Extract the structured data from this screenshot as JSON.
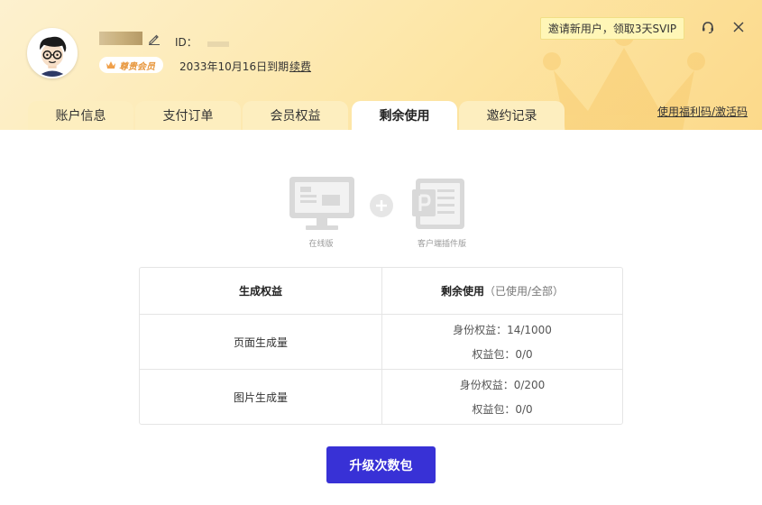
{
  "header": {
    "id_label": "ID：",
    "vip_badge": "尊贵会员",
    "expire_text": "2033年10月16日到期",
    "renew_link": "续费",
    "invite_button": "邀请新用户，领取3天SVIP",
    "promo_link": "使用福利码/激活码"
  },
  "tabs": [
    {
      "label": "账户信息",
      "active": false
    },
    {
      "label": "支付订单",
      "active": false
    },
    {
      "label": "会员权益",
      "active": false
    },
    {
      "label": "剩余使用",
      "active": true
    },
    {
      "label": "邀约记录",
      "active": false
    }
  ],
  "versions": {
    "online": "在线版",
    "client": "客户端插件版"
  },
  "table": {
    "head_left": "生成权益",
    "head_right": "剩余使用",
    "head_right_sub": "（已使用/全部）",
    "rows": [
      {
        "name": "页面生成量",
        "line1": "身份权益：14/1000",
        "line2": "权益包：0/0"
      },
      {
        "name": "图片生成量",
        "line1": "身份权益：0/200",
        "line2": "权益包：0/0"
      }
    ]
  },
  "upgrade_button": "升级次数包",
  "colors": {
    "accent": "#3831d6",
    "header_bg": "#fde6a6",
    "tab_bg": "#fdeebf",
    "invite_bg": "#fff6b7",
    "vip_text": "#e7963c"
  },
  "icons": {
    "edit": "pencil-icon",
    "support": "headset-icon",
    "close": "close-icon",
    "vip": "crown-icon"
  }
}
